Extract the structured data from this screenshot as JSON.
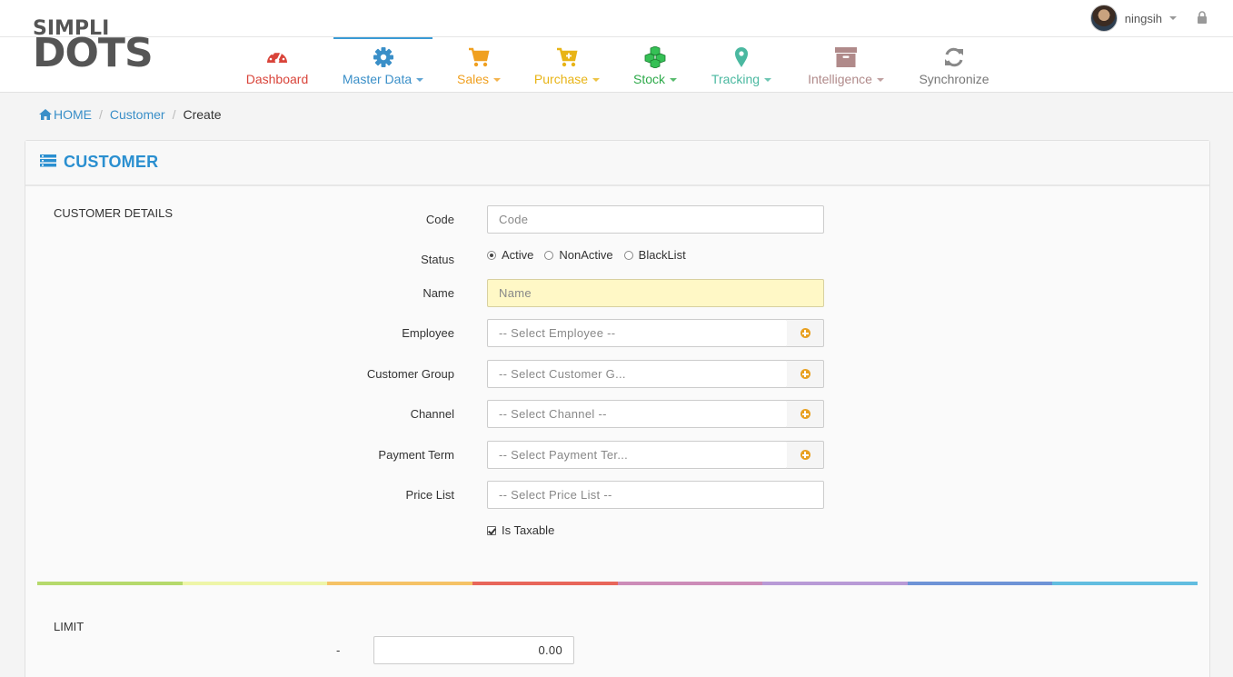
{
  "user": {
    "name": "ningsih"
  },
  "logo": {
    "top": "SIMPLI",
    "bottom": "DOTS"
  },
  "nav": [
    {
      "label": "Dashboard",
      "color": "#d9443a",
      "icon": "speedometer-icon",
      "caret": false
    },
    {
      "label": "Master Data",
      "color": "#3a8fc8",
      "icon": "gear-icon",
      "caret": true,
      "active": true
    },
    {
      "label": "Sales",
      "color": "#f0a020",
      "icon": "cart-icon",
      "caret": true
    },
    {
      "label": "Purchase",
      "color": "#e8b416",
      "icon": "cart-plus-icon",
      "caret": true
    },
    {
      "label": "Stock",
      "color": "#2eaa4a",
      "icon": "cubes-icon",
      "caret": true
    },
    {
      "label": "Tracking",
      "color": "#4ab8a0",
      "icon": "map-marker-icon",
      "caret": true
    },
    {
      "label": "Intelligence",
      "color": "#b08a8a",
      "icon": "archive-icon",
      "caret": true
    },
    {
      "label": "Synchronize",
      "color": "#777777",
      "icon": "refresh-icon",
      "caret": false
    }
  ],
  "breadcrumb": {
    "home": "HOME",
    "parent": "Customer",
    "current": "Create"
  },
  "panel": {
    "title": "CUSTOMER"
  },
  "details": {
    "section": "CUSTOMER DETAILS",
    "code": {
      "label": "Code",
      "placeholder": "Code"
    },
    "status": {
      "label": "Status",
      "options": [
        "Active",
        "NonActive",
        "BlackList"
      ],
      "selected": "Active"
    },
    "name": {
      "label": "Name",
      "placeholder": "Name"
    },
    "employee": {
      "label": "Employee",
      "placeholder": "-- Select Employee --"
    },
    "customer_group": {
      "label": "Customer Group",
      "placeholder": "-- Select Customer G..."
    },
    "channel": {
      "label": "Channel",
      "placeholder": "-- Select Channel --"
    },
    "payment_term": {
      "label": "Payment Term",
      "placeholder": "-- Select Payment Ter..."
    },
    "price_list": {
      "label": "Price List",
      "placeholder": "-- Select Price List --"
    },
    "is_taxable": {
      "label": "Is Taxable",
      "checked": true
    }
  },
  "limit": {
    "section": "LIMIT",
    "label": "-",
    "value": "0.00"
  },
  "rainbow_colors": [
    "#b5d96c",
    "#eef5a8",
    "#f5c266",
    "#e8665a",
    "#cc8cb8",
    "#b89ad6",
    "#6e93d6",
    "#62bde0"
  ]
}
